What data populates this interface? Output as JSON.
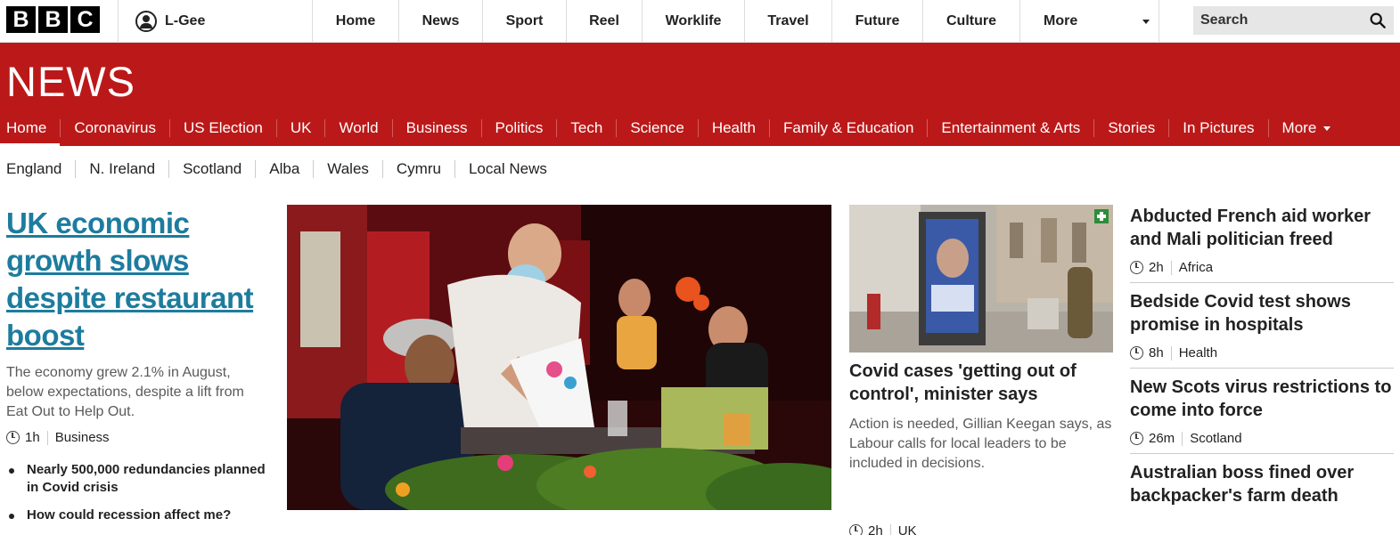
{
  "topbar": {
    "logo_letters": [
      "B",
      "B",
      "C"
    ],
    "account_name": "L-Gee",
    "nav": [
      {
        "label": "Home",
        "width": 97
      },
      {
        "label": "News",
        "width": 94
      },
      {
        "label": "Sport",
        "width": 94
      },
      {
        "label": "Reel",
        "width": 85
      },
      {
        "label": "Worklife",
        "width": 115
      },
      {
        "label": "Travel",
        "width": 98
      },
      {
        "label": "Future",
        "width": 102
      },
      {
        "label": "Culture",
        "width": 109
      }
    ],
    "more_label": "More",
    "search_placeholder": "Search"
  },
  "newsbar": {
    "title": "NEWS",
    "nav": [
      "Home",
      "Coronavirus",
      "US Election",
      "UK",
      "World",
      "Business",
      "Politics",
      "Tech",
      "Science",
      "Health",
      "Family & Education",
      "Entertainment & Arts",
      "Stories",
      "In Pictures"
    ],
    "more_label": "More",
    "active": "Home"
  },
  "subnav": [
    "England",
    "N. Ireland",
    "Scotland",
    "Alba",
    "Wales",
    "Cymru",
    "Local News"
  ],
  "lead": {
    "title": "UK economic growth slows despite restaurant boost",
    "summary": "The economy grew 2.1% in August, below expectations, despite a lift from Eat Out to Help Out.",
    "time": "1h",
    "section": "Business",
    "related": [
      "Nearly 500,000 redundancies planned in Covid crisis",
      "How could recession affect me?"
    ]
  },
  "second": {
    "title": "Covid cases 'getting out of control', minister says",
    "summary": "Action is needed, Gillian Keegan says, as Labour calls for local leaders to be included in decisions.",
    "time": "2h",
    "section": "UK"
  },
  "right": [
    {
      "title": "Abducted French aid worker and Mali politician freed",
      "time": "2h",
      "section": "Africa"
    },
    {
      "title": "Bedside Covid test shows promise in hospitals",
      "time": "8h",
      "section": "Health"
    },
    {
      "title": "New Scots virus restrictions to come into force",
      "time": "26m",
      "section": "Scotland"
    },
    {
      "title": "Australian boss fined over backpacker's farm death",
      "time": "",
      "section": ""
    }
  ],
  "colors": {
    "brand_red": "#bb1919",
    "link_blue": "#1d7c9e"
  }
}
